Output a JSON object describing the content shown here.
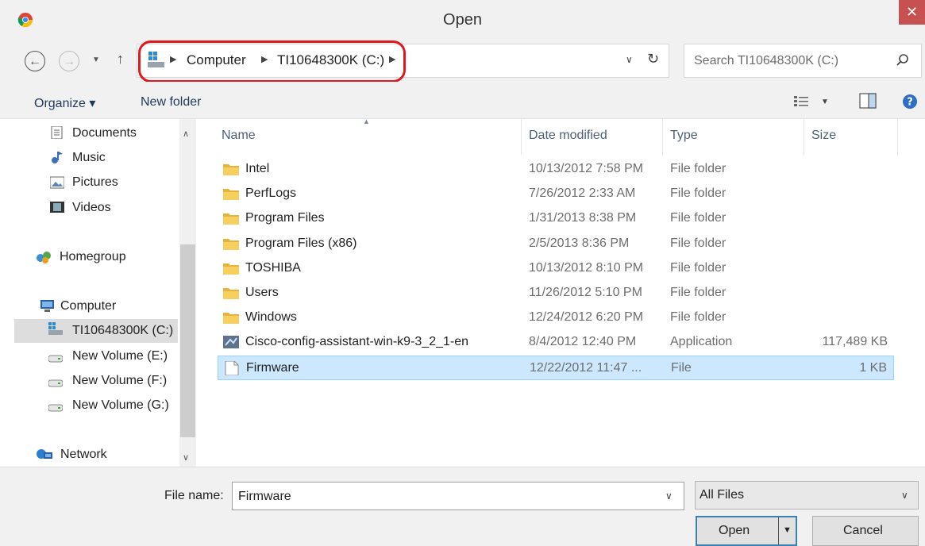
{
  "window": {
    "title": "Open",
    "close_glyph": "✕"
  },
  "address": {
    "crumbs": [
      "Computer",
      "TI10648300K (C:)"
    ],
    "search_placeholder": "Search TI10648300K (C:)"
  },
  "toolbar": {
    "organize_label": "Organize ▾",
    "new_folder_label": "New folder"
  },
  "nav": {
    "items": [
      {
        "label": "Documents",
        "icon": "documents-icon"
      },
      {
        "label": "Music",
        "icon": "music-icon"
      },
      {
        "label": "Pictures",
        "icon": "pictures-icon"
      },
      {
        "label": "Videos",
        "icon": "videos-icon"
      },
      {
        "label": "Homegroup",
        "icon": "homegroup-icon"
      },
      {
        "label": "Computer",
        "icon": "computer-icon"
      },
      {
        "label": "TI10648300K (C:)",
        "icon": "drive-icon",
        "selected": true
      },
      {
        "label": "New Volume (E:)",
        "icon": "drive-icon"
      },
      {
        "label": "New Volume (F:)",
        "icon": "drive-icon"
      },
      {
        "label": "New Volume (G:)",
        "icon": "drive-icon"
      },
      {
        "label": "Network",
        "icon": "network-icon"
      }
    ]
  },
  "columns": {
    "name": "Name",
    "date": "Date modified",
    "type": "Type",
    "size": "Size"
  },
  "files": [
    {
      "name": "Intel",
      "date": "10/13/2012 7:58 PM",
      "type": "File folder",
      "size": "",
      "icon": "folder-icon"
    },
    {
      "name": "PerfLogs",
      "date": "7/26/2012 2:33 AM",
      "type": "File folder",
      "size": "",
      "icon": "folder-icon"
    },
    {
      "name": "Program Files",
      "date": "1/31/2013 8:38 PM",
      "type": "File folder",
      "size": "",
      "icon": "folder-icon"
    },
    {
      "name": "Program Files (x86)",
      "date": "2/5/2013 8:36 PM",
      "type": "File folder",
      "size": "",
      "icon": "folder-icon"
    },
    {
      "name": "TOSHIBA",
      "date": "10/13/2012 8:10 PM",
      "type": "File folder",
      "size": "",
      "icon": "folder-icon"
    },
    {
      "name": "Users",
      "date": "11/26/2012 5:10 PM",
      "type": "File folder",
      "size": "",
      "icon": "folder-icon"
    },
    {
      "name": "Windows",
      "date": "12/24/2012 6:20 PM",
      "type": "File folder",
      "size": "",
      "icon": "folder-icon"
    },
    {
      "name": "Cisco-config-assistant-win-k9-3_2_1-en",
      "date": "8/4/2012 12:40 PM",
      "type": "Application",
      "size": "117,489 KB",
      "icon": "application-icon"
    },
    {
      "name": "Firmware",
      "date": "12/22/2012 11:47 ...",
      "type": "File",
      "size": "1 KB",
      "icon": "file-icon",
      "selected": true
    }
  ],
  "bottom": {
    "file_name_label": "File name:",
    "file_name_value": "Firmware",
    "file_type_value": "All Files",
    "open_label": "Open",
    "cancel_label": "Cancel"
  },
  "colors": {
    "selection": "#cce8ff",
    "highlight_ring": "#e0181f",
    "close": "#c75050"
  }
}
